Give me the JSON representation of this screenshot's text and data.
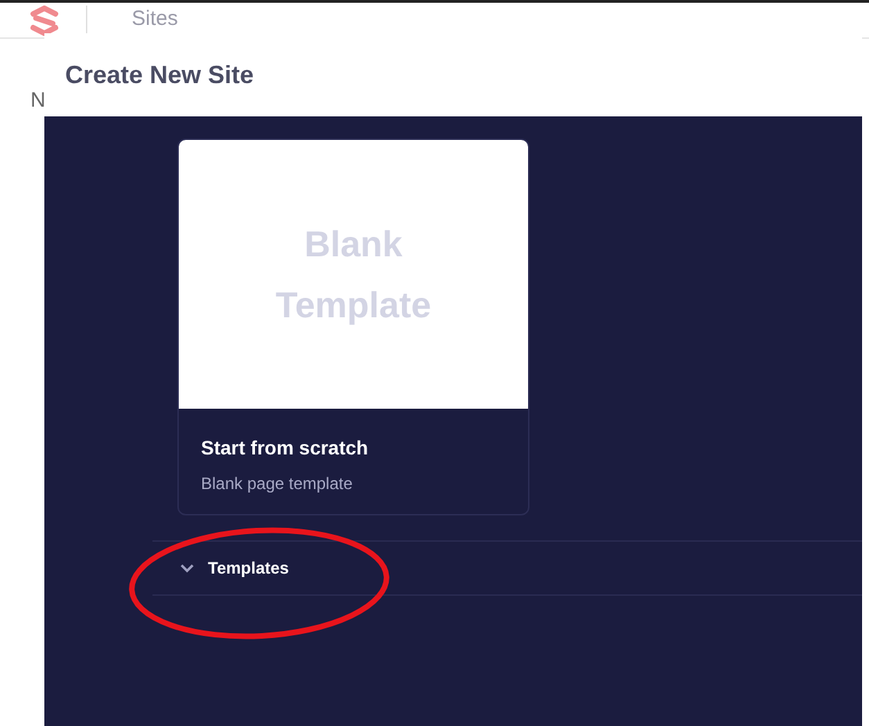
{
  "app_bar": {
    "title": "Sites"
  },
  "background_page": {
    "cut_text": "N"
  },
  "dialog": {
    "title": "Create New Site",
    "blank_card": {
      "preview_text": "Blank Template",
      "title": "Start from scratch",
      "subtitle": "Blank page template"
    },
    "templates_section": {
      "label": "Templates",
      "expanded": false
    }
  },
  "annotation": {
    "kind": "ellipse",
    "color": "#e8141c"
  }
}
